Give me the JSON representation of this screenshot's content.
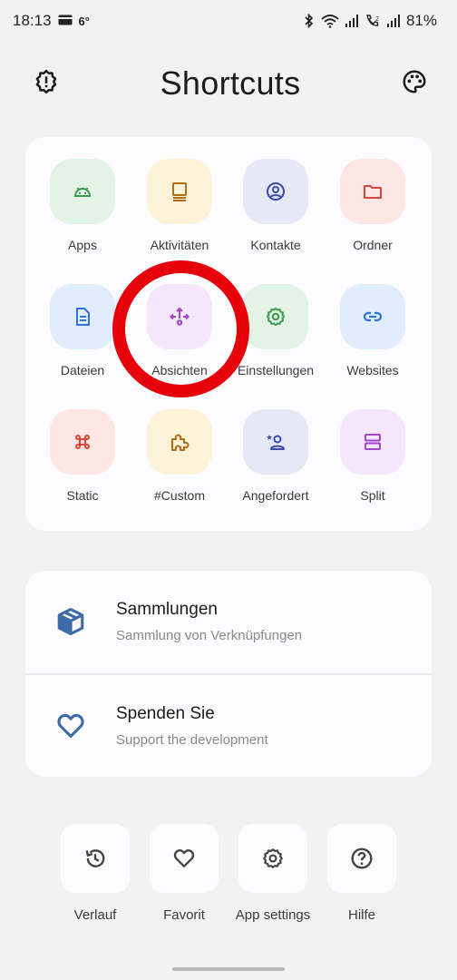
{
  "status_bar": {
    "time": "18:13",
    "temperature": "6°",
    "battery": "81%"
  },
  "header": {
    "title": "Shortcuts",
    "left_icon": "settings-icon",
    "right_icon": "palette-icon"
  },
  "grid": [
    {
      "label": "Apps",
      "icon": "android-icon",
      "bg": "#e3f3e6",
      "fg": "#3a9a4c"
    },
    {
      "label": "Aktivitäten",
      "icon": "activity-icon",
      "bg": "#fdf3d9",
      "fg": "#b36a12"
    },
    {
      "label": "Kontakte",
      "icon": "contact-icon",
      "bg": "#e6e8f6",
      "fg": "#3d4bb0"
    },
    {
      "label": "Ordner",
      "icon": "folder-icon",
      "bg": "#fde6e3",
      "fg": "#d8453a"
    },
    {
      "label": "Dateien",
      "icon": "file-icon",
      "bg": "#e1edfd",
      "fg": "#2f74d8"
    },
    {
      "label": "Absichten",
      "icon": "intent-icon",
      "bg": "#f4e6fb",
      "fg": "#a044c8"
    },
    {
      "label": "Einstellungen",
      "icon": "settings-gear-icon",
      "bg": "#e3f3e6",
      "fg": "#3a9a4c"
    },
    {
      "label": "Websites",
      "icon": "link-icon",
      "bg": "#e1edfd",
      "fg": "#2f74d8"
    },
    {
      "label": "Static",
      "icon": "command-icon",
      "bg": "#fde6e3",
      "fg": "#d8453a"
    },
    {
      "label": "#Custom",
      "icon": "puzzle-icon",
      "bg": "#fdf3d9",
      "fg": "#b36a12"
    },
    {
      "label": "Angefordert",
      "icon": "person-star-icon",
      "bg": "#e6e8f6",
      "fg": "#3d4bb0"
    },
    {
      "label": "Split",
      "icon": "split-icon",
      "bg": "#f4e6fb",
      "fg": "#a044c8"
    }
  ],
  "list": [
    {
      "title": "Sammlungen",
      "subtitle": "Sammlung von Verknüpfungen",
      "icon": "box-icon"
    },
    {
      "title": "Spenden Sie",
      "subtitle": "Support the development",
      "icon": "heart-icon"
    }
  ],
  "bottom_actions": [
    {
      "label": "Verlauf",
      "icon": "history-icon"
    },
    {
      "label": "Favorit",
      "icon": "favorite-icon"
    },
    {
      "label": "App settings",
      "icon": "app-settings-icon"
    },
    {
      "label": "Hilfe",
      "icon": "help-icon"
    }
  ],
  "colors": {
    "background": "#f2f2f2",
    "card": "#fcfcfe",
    "highlight_ring": "#e6000a",
    "list_icon": "#3f6aa8"
  }
}
